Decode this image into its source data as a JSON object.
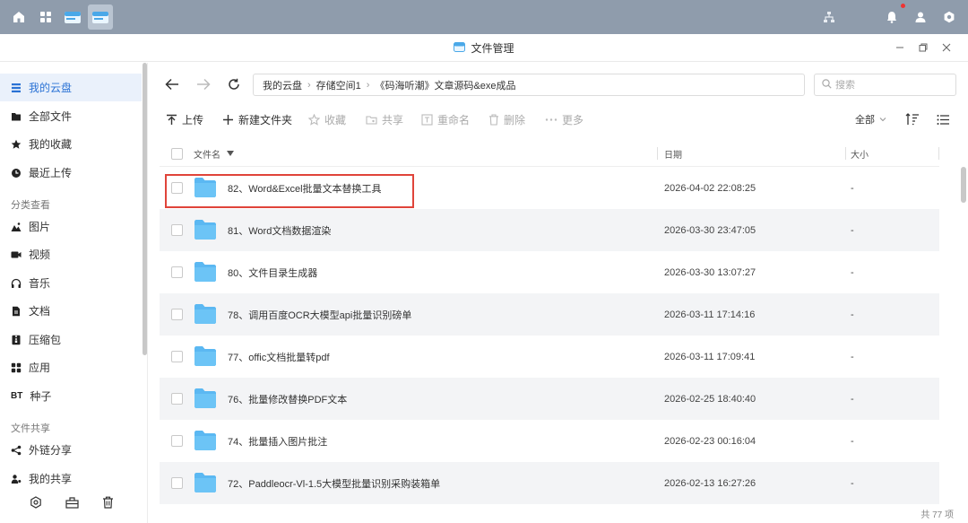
{
  "window": {
    "title": "文件管理"
  },
  "sidebar": {
    "items": [
      {
        "label": "我的云盘",
        "icon": "list-icon",
        "active": true
      },
      {
        "label": "全部文件",
        "icon": "folder-icon"
      },
      {
        "label": "我的收藏",
        "icon": "star-icon"
      },
      {
        "label": "最近上传",
        "icon": "clock-icon"
      }
    ],
    "section_category": "分类查看",
    "categories": [
      {
        "label": "图片",
        "icon": "image-icon"
      },
      {
        "label": "视频",
        "icon": "video-icon"
      },
      {
        "label": "音乐",
        "icon": "headphones-icon"
      },
      {
        "label": "文档",
        "icon": "document-icon"
      },
      {
        "label": "压缩包",
        "icon": "archive-icon"
      },
      {
        "label": "应用",
        "icon": "apps-icon"
      },
      {
        "label": "种子",
        "icon": "bt-icon",
        "prefix": "BT"
      }
    ],
    "section_share": "文件共享",
    "share_items": [
      {
        "label": "外链分享",
        "icon": "share-icon"
      },
      {
        "label": "我的共享",
        "icon": "user-share-icon"
      }
    ]
  },
  "breadcrumb": [
    "我的云盘",
    "存储空间1",
    "《码海听潮》文章源码&exe成品"
  ],
  "search": {
    "placeholder": "搜索"
  },
  "toolbar": {
    "upload": "上传",
    "new_folder": "新建文件夹",
    "favorite": "收藏",
    "share": "共享",
    "rename": "重命名",
    "delete": "删除",
    "more": "更多",
    "filter": "全部"
  },
  "columns": {
    "name": "文件名",
    "date": "日期",
    "size": "大小"
  },
  "rows": [
    {
      "name": "82、Word&Excel批量文本替换工具",
      "date": "2026-04-02 22:08:25",
      "size": "-"
    },
    {
      "name": "81、Word文档数据渲染",
      "date": "2026-03-30 23:47:05",
      "size": "-"
    },
    {
      "name": "80、文件目录生成器",
      "date": "2026-03-30 13:07:27",
      "size": "-"
    },
    {
      "name": "78、调用百度OCR大模型api批量识别磅单",
      "date": "2026-03-11 17:14:16",
      "size": "-"
    },
    {
      "name": "77、offic文档批量转pdf",
      "date": "2026-03-11 17:09:41",
      "size": "-"
    },
    {
      "name": "76、批量修改替换PDF文本",
      "date": "2026-02-25 18:40:40",
      "size": "-"
    },
    {
      "name": "74、批量插入图片批注",
      "date": "2026-02-23 00:16:04",
      "size": "-"
    },
    {
      "name": "72、Paddleocr-Vl-1.5大模型批量识别采购装箱单",
      "date": "2026-02-13 16:27:26",
      "size": "-"
    }
  ],
  "footer": {
    "count": "共 77 项"
  },
  "colors": {
    "accent": "#2a72d5",
    "folder": "#5bb8f2",
    "highlight": "#e0443a",
    "osbar": "#8f9cac"
  }
}
